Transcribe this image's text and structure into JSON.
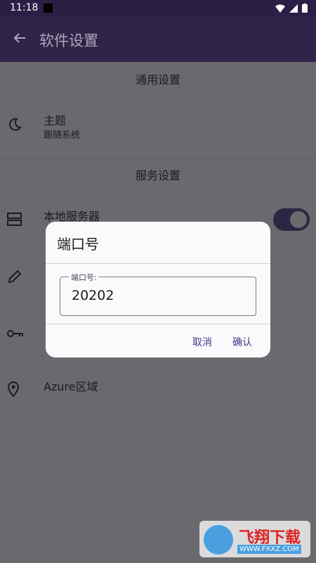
{
  "status": {
    "time": "11:18"
  },
  "appbar": {
    "title": "软件设置"
  },
  "sections": {
    "general": "通用设置",
    "service": "服务设置"
  },
  "settings": {
    "theme": {
      "label": "主题",
      "value": "跟随系统"
    },
    "local_server": {
      "label": "本地服务器",
      "enabled": true
    },
    "azure_region": {
      "label": "Azure区域"
    }
  },
  "dialog": {
    "title": "端口号",
    "field_label": "端口号:",
    "field_value": "20202",
    "cancel": "取消",
    "confirm": "确认"
  },
  "watermark": {
    "brand": "飞翔下载",
    "url": "WWW.FXXZ.COM"
  },
  "colors": {
    "appbar": "#2f2548",
    "scrim": "#6b696e",
    "accent": "#3e3a8a"
  }
}
